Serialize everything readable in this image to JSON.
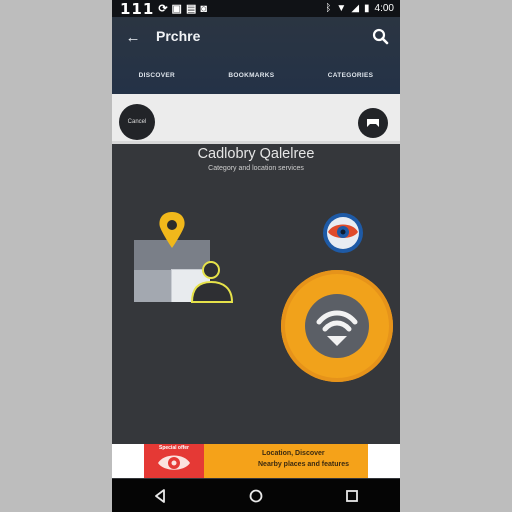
{
  "status_bar": {
    "left_text": "111",
    "left_icons": [
      "sync-icon",
      "image-icon",
      "lock-icon",
      "camera-icon"
    ],
    "right_icons": [
      "bluetooth-icon",
      "wifi-icon",
      "signal-icon",
      "battery-icon"
    ],
    "time": "4:00"
  },
  "toolbar": {
    "title": "Prchre",
    "back_icon": "arrow-back-icon",
    "search_icon": "search-icon",
    "tabs": [
      {
        "label": "DISCOVER"
      },
      {
        "label": "BOOKMARKS"
      },
      {
        "label": "CATEGORIES"
      }
    ]
  },
  "strip": {
    "pill_label": "Cancel",
    "round_button_icon": "bookmark-icon"
  },
  "main": {
    "heading": "Cadlobry Qalelree",
    "subheading": "Category and location services"
  },
  "banner": {
    "badge_caption": "Special offer",
    "line1": "Location, Discover",
    "line2": "Nearby places and features"
  },
  "colors": {
    "status_bar": "#101216",
    "toolbar": "#263346",
    "content_bg": "#35373b",
    "accent_orange": "#f1a21b",
    "banner_red": "#e53935",
    "navbar": "#050505"
  }
}
